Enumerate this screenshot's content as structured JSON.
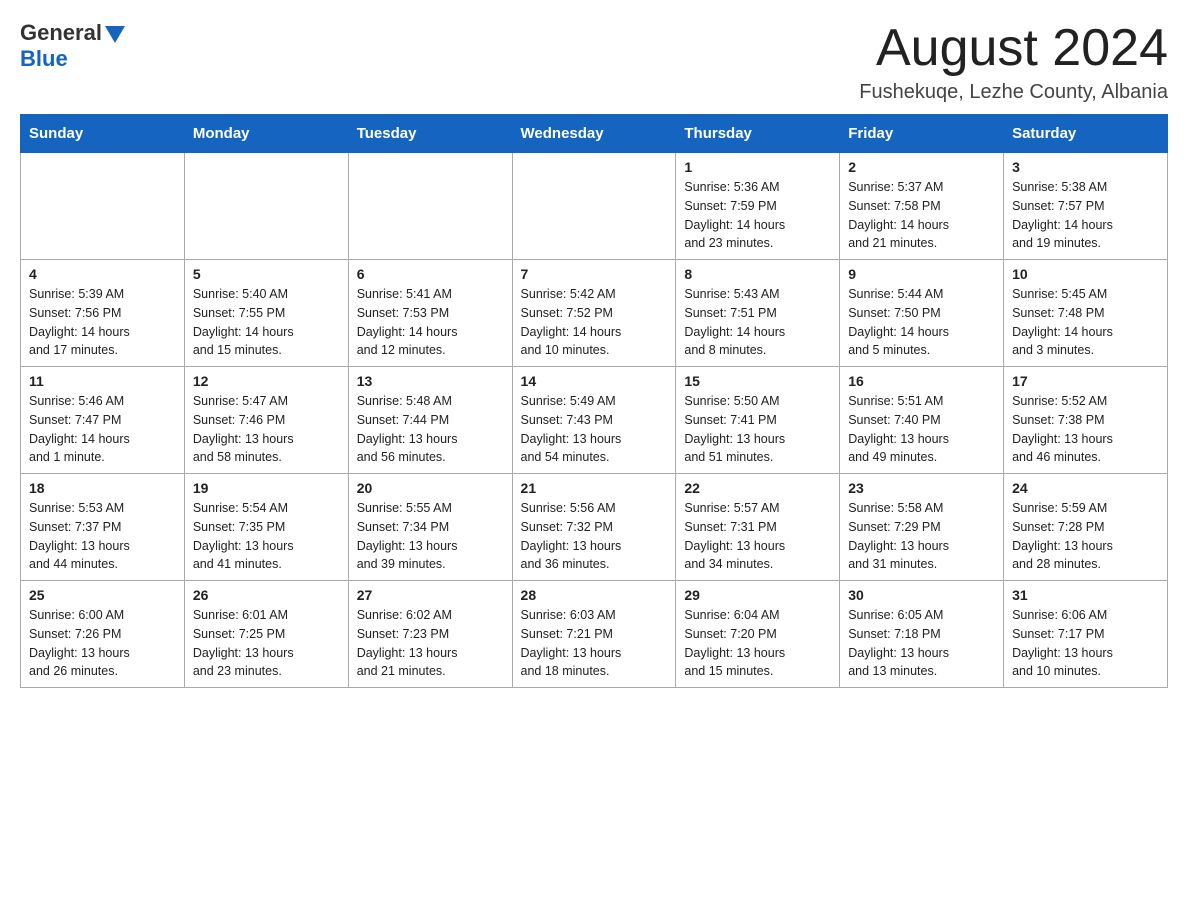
{
  "logo": {
    "general": "General",
    "blue": "Blue"
  },
  "title": "August 2024",
  "subtitle": "Fushekuqe, Lezhe County, Albania",
  "weekdays": [
    "Sunday",
    "Monday",
    "Tuesday",
    "Wednesday",
    "Thursday",
    "Friday",
    "Saturday"
  ],
  "weeks": [
    {
      "days": [
        {
          "number": "",
          "info": ""
        },
        {
          "number": "",
          "info": ""
        },
        {
          "number": "",
          "info": ""
        },
        {
          "number": "",
          "info": ""
        },
        {
          "number": "1",
          "info": "Sunrise: 5:36 AM\nSunset: 7:59 PM\nDaylight: 14 hours\nand 23 minutes."
        },
        {
          "number": "2",
          "info": "Sunrise: 5:37 AM\nSunset: 7:58 PM\nDaylight: 14 hours\nand 21 minutes."
        },
        {
          "number": "3",
          "info": "Sunrise: 5:38 AM\nSunset: 7:57 PM\nDaylight: 14 hours\nand 19 minutes."
        }
      ]
    },
    {
      "days": [
        {
          "number": "4",
          "info": "Sunrise: 5:39 AM\nSunset: 7:56 PM\nDaylight: 14 hours\nand 17 minutes."
        },
        {
          "number": "5",
          "info": "Sunrise: 5:40 AM\nSunset: 7:55 PM\nDaylight: 14 hours\nand 15 minutes."
        },
        {
          "number": "6",
          "info": "Sunrise: 5:41 AM\nSunset: 7:53 PM\nDaylight: 14 hours\nand 12 minutes."
        },
        {
          "number": "7",
          "info": "Sunrise: 5:42 AM\nSunset: 7:52 PM\nDaylight: 14 hours\nand 10 minutes."
        },
        {
          "number": "8",
          "info": "Sunrise: 5:43 AM\nSunset: 7:51 PM\nDaylight: 14 hours\nand 8 minutes."
        },
        {
          "number": "9",
          "info": "Sunrise: 5:44 AM\nSunset: 7:50 PM\nDaylight: 14 hours\nand 5 minutes."
        },
        {
          "number": "10",
          "info": "Sunrise: 5:45 AM\nSunset: 7:48 PM\nDaylight: 14 hours\nand 3 minutes."
        }
      ]
    },
    {
      "days": [
        {
          "number": "11",
          "info": "Sunrise: 5:46 AM\nSunset: 7:47 PM\nDaylight: 14 hours\nand 1 minute."
        },
        {
          "number": "12",
          "info": "Sunrise: 5:47 AM\nSunset: 7:46 PM\nDaylight: 13 hours\nand 58 minutes."
        },
        {
          "number": "13",
          "info": "Sunrise: 5:48 AM\nSunset: 7:44 PM\nDaylight: 13 hours\nand 56 minutes."
        },
        {
          "number": "14",
          "info": "Sunrise: 5:49 AM\nSunset: 7:43 PM\nDaylight: 13 hours\nand 54 minutes."
        },
        {
          "number": "15",
          "info": "Sunrise: 5:50 AM\nSunset: 7:41 PM\nDaylight: 13 hours\nand 51 minutes."
        },
        {
          "number": "16",
          "info": "Sunrise: 5:51 AM\nSunset: 7:40 PM\nDaylight: 13 hours\nand 49 minutes."
        },
        {
          "number": "17",
          "info": "Sunrise: 5:52 AM\nSunset: 7:38 PM\nDaylight: 13 hours\nand 46 minutes."
        }
      ]
    },
    {
      "days": [
        {
          "number": "18",
          "info": "Sunrise: 5:53 AM\nSunset: 7:37 PM\nDaylight: 13 hours\nand 44 minutes."
        },
        {
          "number": "19",
          "info": "Sunrise: 5:54 AM\nSunset: 7:35 PM\nDaylight: 13 hours\nand 41 minutes."
        },
        {
          "number": "20",
          "info": "Sunrise: 5:55 AM\nSunset: 7:34 PM\nDaylight: 13 hours\nand 39 minutes."
        },
        {
          "number": "21",
          "info": "Sunrise: 5:56 AM\nSunset: 7:32 PM\nDaylight: 13 hours\nand 36 minutes."
        },
        {
          "number": "22",
          "info": "Sunrise: 5:57 AM\nSunset: 7:31 PM\nDaylight: 13 hours\nand 34 minutes."
        },
        {
          "number": "23",
          "info": "Sunrise: 5:58 AM\nSunset: 7:29 PM\nDaylight: 13 hours\nand 31 minutes."
        },
        {
          "number": "24",
          "info": "Sunrise: 5:59 AM\nSunset: 7:28 PM\nDaylight: 13 hours\nand 28 minutes."
        }
      ]
    },
    {
      "days": [
        {
          "number": "25",
          "info": "Sunrise: 6:00 AM\nSunset: 7:26 PM\nDaylight: 13 hours\nand 26 minutes."
        },
        {
          "number": "26",
          "info": "Sunrise: 6:01 AM\nSunset: 7:25 PM\nDaylight: 13 hours\nand 23 minutes."
        },
        {
          "number": "27",
          "info": "Sunrise: 6:02 AM\nSunset: 7:23 PM\nDaylight: 13 hours\nand 21 minutes."
        },
        {
          "number": "28",
          "info": "Sunrise: 6:03 AM\nSunset: 7:21 PM\nDaylight: 13 hours\nand 18 minutes."
        },
        {
          "number": "29",
          "info": "Sunrise: 6:04 AM\nSunset: 7:20 PM\nDaylight: 13 hours\nand 15 minutes."
        },
        {
          "number": "30",
          "info": "Sunrise: 6:05 AM\nSunset: 7:18 PM\nDaylight: 13 hours\nand 13 minutes."
        },
        {
          "number": "31",
          "info": "Sunrise: 6:06 AM\nSunset: 7:17 PM\nDaylight: 13 hours\nand 10 minutes."
        }
      ]
    }
  ]
}
